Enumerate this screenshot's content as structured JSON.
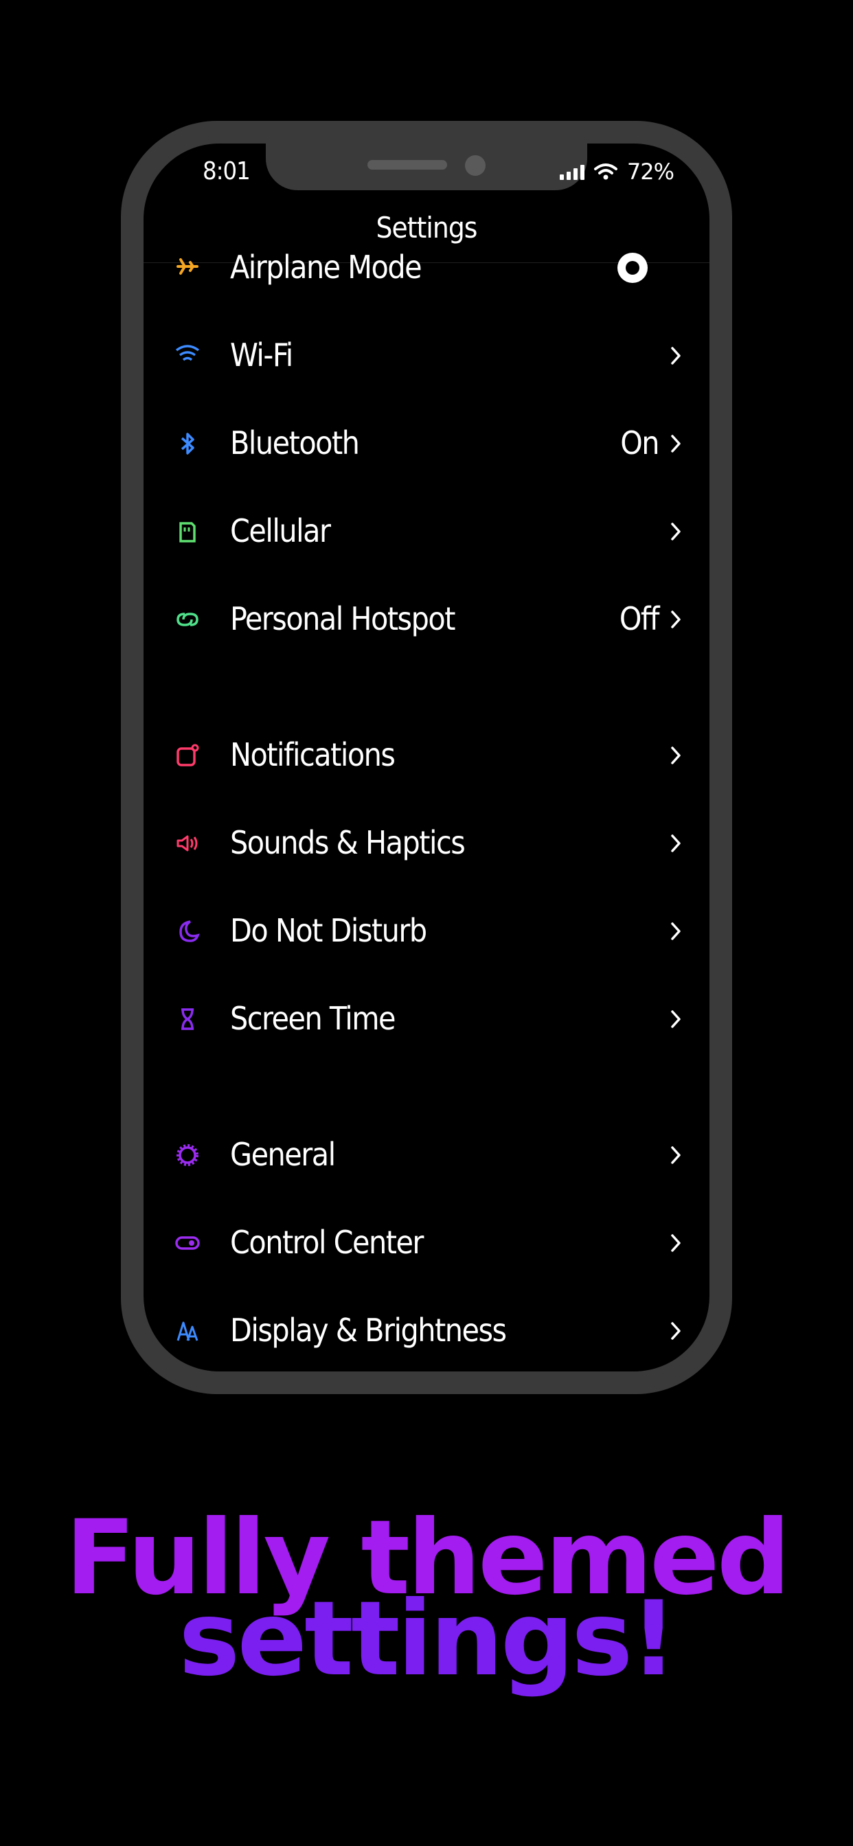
{
  "status_bar": {
    "time": "8:01",
    "battery": "72%"
  },
  "nav": {
    "title": "Settings"
  },
  "groups": [
    [
      {
        "label": "Airplane Mode",
        "value": "",
        "icon": "airplane-icon",
        "color": "#f5a623",
        "control": "toggle"
      },
      {
        "label": "Wi-Fi",
        "value": "",
        "icon": "wifi-icon",
        "color": "#3d8bff",
        "control": "chevron"
      },
      {
        "label": "Bluetooth",
        "value": "On",
        "icon": "bluetooth-icon",
        "color": "#3d8bff",
        "control": "chevron"
      },
      {
        "label": "Cellular",
        "value": "",
        "icon": "cellular-icon",
        "color": "#5fe070",
        "control": "chevron"
      },
      {
        "label": "Personal Hotspot",
        "value": "Off",
        "icon": "hotspot-icon",
        "color": "#4fe08a",
        "control": "chevron"
      }
    ],
    [
      {
        "label": "Notifications",
        "value": "",
        "icon": "notifications-icon",
        "color": "#ff3b6b",
        "control": "chevron"
      },
      {
        "label": "Sounds & Haptics",
        "value": "",
        "icon": "speaker-icon",
        "color": "#ff3b6b",
        "control": "chevron"
      },
      {
        "label": "Do Not Disturb",
        "value": "",
        "icon": "moon-icon",
        "color": "#8a2cf0",
        "control": "chevron"
      },
      {
        "label": "Screen Time",
        "value": "",
        "icon": "hourglass-icon",
        "color": "#8a2cf0",
        "control": "chevron"
      }
    ],
    [
      {
        "label": "General",
        "value": "",
        "icon": "gear-icon",
        "color": "#9b2cf0",
        "control": "chevron"
      },
      {
        "label": "Control Center",
        "value": "",
        "icon": "toggle-icon",
        "color": "#9b2cf0",
        "control": "chevron"
      },
      {
        "label": "Display & Brightness",
        "value": "",
        "icon": "display-icon",
        "color": "#3d8bff",
        "control": "chevron"
      }
    ]
  ],
  "headline": {
    "line1": "Fully themed",
    "line2": "settings!"
  }
}
